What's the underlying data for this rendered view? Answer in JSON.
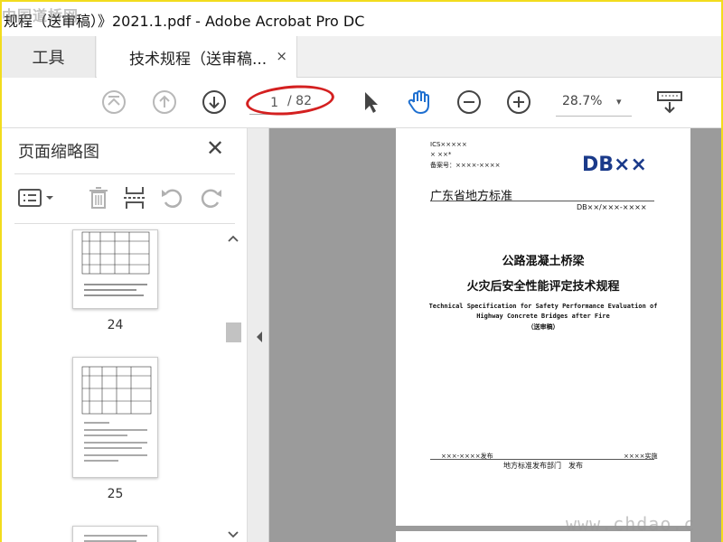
{
  "window": {
    "title": "规程（送审稿）》2021.1.pdf - Adobe Acrobat Pro DC",
    "watermark_top": "中国道桥网"
  },
  "tabs": {
    "tools_label": "工具",
    "doc_label": "技术规程（送审稿...",
    "close_glyph": "×"
  },
  "toolbar": {
    "current_page": "1",
    "total_pages": "/ 82",
    "zoom": "28.7%",
    "zoom_caret": "▾"
  },
  "sidebar": {
    "title": "页面缩略图",
    "close_glyph": "✕",
    "thumbnails": [
      {
        "page_label": "24"
      },
      {
        "page_label": "25"
      }
    ]
  },
  "document": {
    "top_line1": "ICS×××××",
    "top_line2": "× ××*",
    "top_line3": "备案号：××××-××××",
    "logo": "DB××",
    "standard_type": "广东省地方标准",
    "doc_number": "DB××/×××-××××",
    "title_cn_1": "公路混凝土桥梁",
    "title_cn_2": "火灾后安全性能评定技术规程",
    "title_en_1": "Technical Specification for Safety Performance Evaluation of",
    "title_en_2": "Highway Concrete Bridges after Fire",
    "draft_note": "（送审稿）",
    "issue_date": "×××-××××发布",
    "effective_date": "××××实施",
    "publisher": "地方标准发布部门　发布"
  },
  "watermark_bottom": "www.chdao.c",
  "colors": {
    "accent_blue": "#1a3a8a",
    "annotation_red": "#d42020",
    "window_border": "#f2dc1e",
    "canvas_gray": "#9b9b9b"
  }
}
